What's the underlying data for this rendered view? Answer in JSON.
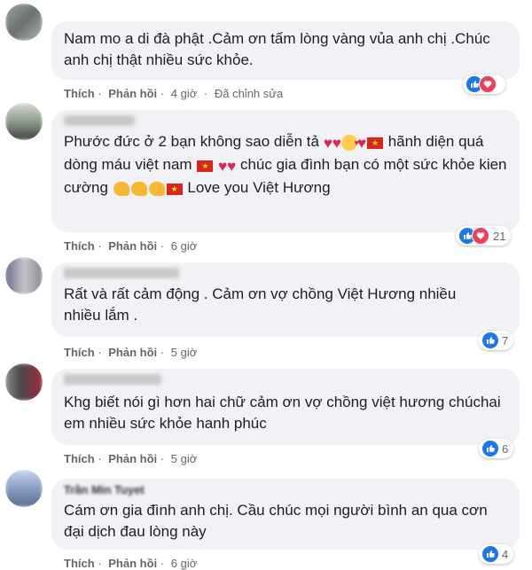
{
  "comments": [
    {
      "text": "Nam mo a di đà phật .Cảm ơn tấm lòng vàng vủa anh chị .Chúc anh chị thật nhiều sức khỏe.",
      "like": "Thích",
      "reply": "Phản hồi",
      "time": "4 giờ",
      "edited": "Đã chỉnh sửa",
      "reactions": [
        "like-icon",
        "love-icon"
      ],
      "count": ""
    },
    {
      "text_parts": [
        "Phước đức ở 2 bạn không sao diễn tả ",
        " hãnh diện quá dòng máu việt nam ",
        " chúc gia đình bạn có một sức khỏe kien cường ",
        " Love you Việt Hương"
      ],
      "like": "Thích",
      "reply": "Phản hồi",
      "time": "6 giờ",
      "reactions": [
        "like-icon",
        "love-icon"
      ],
      "count": "21"
    },
    {
      "text": "Rất và rất cảm động . Cảm ơn vợ chồng Việt Hương nhiều nhiều lắm .",
      "like": "Thích",
      "reply": "Phản hồi",
      "time": "5 giờ",
      "reactions": [
        "like-icon"
      ],
      "count": "7"
    },
    {
      "text": "Khg biết nói gì hơn hai chữ cảm ơn vợ chồng việt hương chúchai em nhiều sức khỏe hanh phúc",
      "like": "Thích",
      "reply": "Phản hồi",
      "time": "5 giờ",
      "reactions": [
        "like-icon"
      ],
      "count": "6"
    },
    {
      "name": "Trần Min Tuyet",
      "text": "Cám ơn gia đình anh chị. Cầu chúc mọi người bình an qua cơn đại dịch đau lòng này",
      "like": "Thích",
      "reply": "Phản hồi",
      "time": "6 giờ",
      "reactions": [
        "like-icon"
      ],
      "count": "4"
    }
  ],
  "separator": "·",
  "colors": {
    "like": "#1877f2",
    "love": "#f33e58",
    "bubble": "#f0f2f5",
    "meta": "#65676b"
  }
}
